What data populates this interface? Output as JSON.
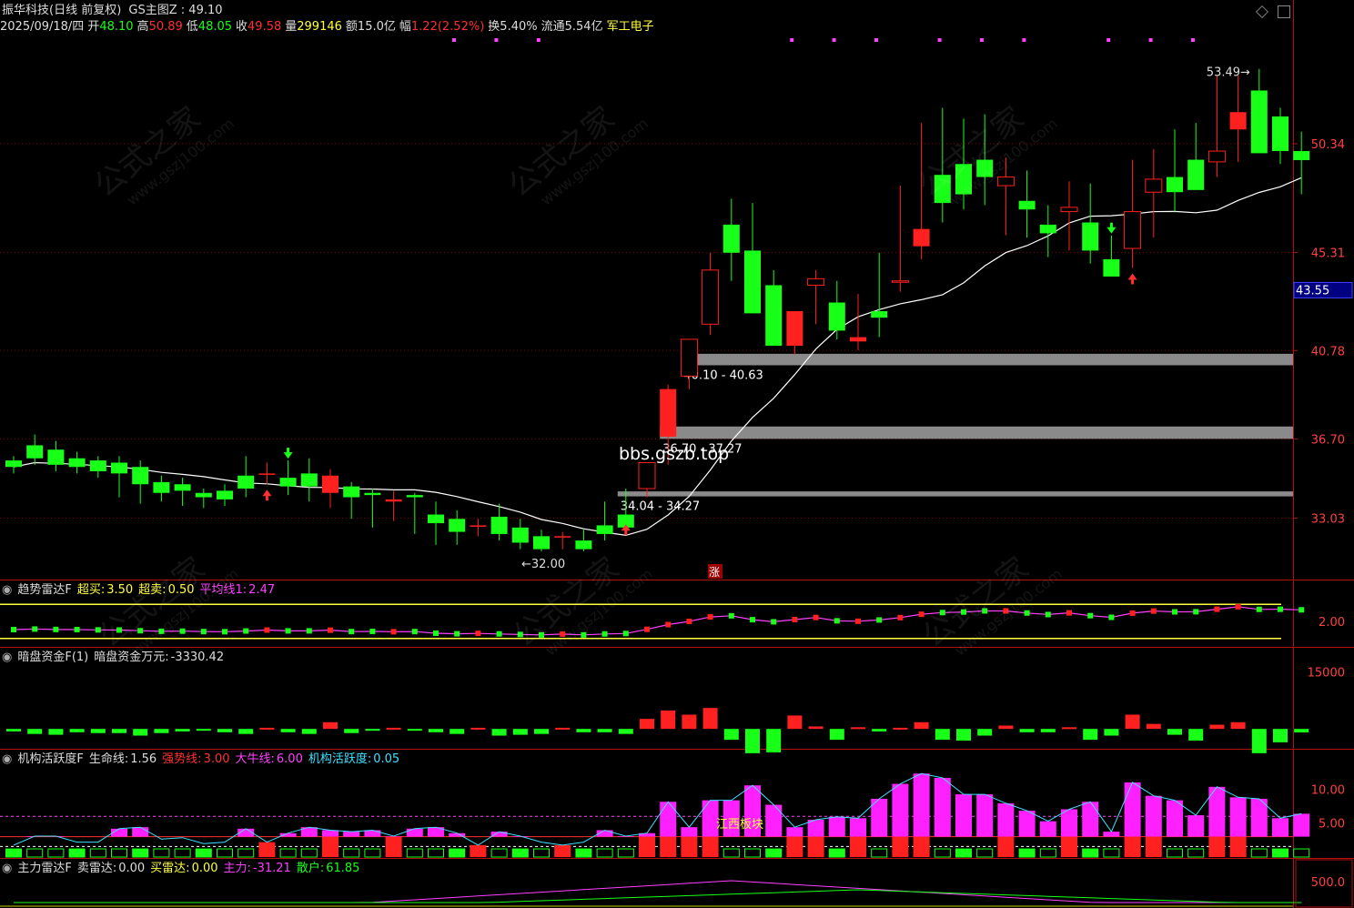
{
  "header": {
    "stock_name": "振华科技(日线 前复权)",
    "main_chart_label": "GS主图Z : 49.10",
    "date": "2025/09/18/四",
    "open_label": "开",
    "open": "48.10",
    "high_label": "高",
    "high": "50.89",
    "low_label": "低",
    "low": "48.05",
    "close_label": "收",
    "close": "49.58",
    "volume_label": "量",
    "volume": "299146",
    "amount_label": "额",
    "amount": "15.0亿",
    "change_label": "幅",
    "change": "1.22(2.52%)",
    "turnover_label": "换",
    "turnover": "5.40%",
    "float_label": "流通",
    "float_cap": "5.54亿",
    "sector": "军工电子"
  },
  "watermarks": {
    "cn": "公式之家",
    "url": "www.gszj100.com"
  },
  "chart_data": [
    {
      "type": "candlestick",
      "ylim": [
        30.7,
        55.3
      ],
      "y_ticks": [
        "50.34",
        "45.31",
        "40.78",
        "36.70",
        "33.03"
      ],
      "current_price_label": "43.55",
      "open": [
        35.7,
        36.4,
        36.2,
        35.8,
        35.7,
        35.6,
        35.4,
        34.7,
        34.6,
        34.2,
        34.3,
        35.0,
        35.1,
        34.9,
        35.1,
        34.2,
        34.5,
        34.2,
        33.8,
        34.1,
        33.2,
        33.0,
        32.7,
        33.1,
        32.6,
        32.2,
        32.2,
        32.0,
        32.7,
        33.2,
        34.4,
        36.8,
        39.6,
        42.0,
        46.6,
        45.4,
        43.8,
        41.0,
        43.8,
        43.0,
        41.2,
        42.6,
        44.0,
        45.6,
        48.9,
        49.4,
        49.6,
        48.4,
        47.7,
        46.6,
        47.2,
        46.7,
        45.0,
        45.5,
        48.1,
        48.8,
        49.6,
        49.5,
        51.0,
        52.8,
        51.6,
        50.0
      ],
      "high": [
        35.9,
        36.9,
        36.6,
        36.1,
        35.9,
        35.9,
        35.7,
        35.0,
        34.9,
        34.4,
        34.6,
        35.9,
        35.6,
        35.7,
        35.8,
        35.3,
        34.7,
        34.4,
        34.3,
        34.2,
        33.8,
        33.4,
        33.0,
        33.7,
        33.0,
        32.5,
        32.4,
        32.5,
        33.8,
        34.4,
        35.6,
        39.2,
        41.0,
        45.3,
        47.8,
        47.6,
        44.5,
        42.6,
        44.5,
        44.0,
        43.4,
        45.3,
        48.4,
        51.3,
        52.0,
        51.5,
        51.7,
        49.7,
        49.1,
        47.5,
        48.6,
        48.5,
        46.1,
        49.6,
        50.1,
        51.0,
        51.3,
        53.5,
        53.5,
        53.8,
        52.0,
        50.9
      ],
      "low": [
        35.1,
        35.5,
        35.2,
        35.1,
        34.9,
        34.0,
        33.7,
        33.8,
        33.6,
        33.5,
        33.6,
        34.0,
        34.6,
        34.1,
        33.8,
        33.5,
        33.0,
        32.6,
        32.9,
        32.3,
        31.8,
        31.8,
        32.2,
        32.0,
        31.6,
        31.5,
        31.6,
        31.5,
        32.0,
        33.0,
        34.0,
        35.5,
        39.0,
        41.5,
        44.0,
        42.8,
        41.0,
        40.6,
        42.0,
        41.3,
        40.8,
        41.4,
        43.5,
        45.0,
        46.7,
        47.3,
        47.5,
        46.1,
        46.0,
        45.1,
        45.4,
        44.8,
        44.4,
        44.6,
        46.0,
        47.2,
        48.5,
        48.8,
        49.5,
        49.9,
        49.4,
        48.0
      ],
      "close": [
        35.4,
        35.8,
        35.5,
        35.4,
        35.2,
        35.1,
        34.6,
        34.2,
        34.3,
        34.0,
        33.9,
        34.4,
        35.1,
        34.5,
        34.5,
        35.0,
        34.0,
        34.1,
        33.9,
        34.0,
        32.8,
        32.4,
        32.7,
        32.3,
        31.9,
        31.6,
        32.2,
        31.6,
        32.3,
        32.6,
        35.6,
        39.0,
        41.3,
        44.5,
        45.3,
        42.5,
        41.0,
        42.6,
        44.1,
        41.7,
        41.4,
        42.3,
        44.0,
        46.4,
        47.6,
        48.0,
        48.8,
        48.8,
        47.3,
        46.2,
        47.4,
        45.4,
        44.2,
        47.2,
        48.7,
        48.1,
        48.2,
        50.0,
        51.8,
        49.9,
        50.0,
        49.58
      ]
    },
    {
      "type": "line",
      "series": [
        {
          "name": "平均线1",
          "values": [
            2.47
          ]
        }
      ]
    }
  ],
  "chart_annotations": {
    "zones": [
      {
        "label": "40.10 - 40.63",
        "low": 40.1,
        "high": 40.63
      },
      {
        "label": "36.70 - 37.27",
        "low": 36.7,
        "high": 37.27
      },
      {
        "label": "34.04 - 34.27",
        "low": 34.04,
        "high": 34.27
      }
    ],
    "low_marker": "←32.00",
    "high_marker": "53.49→",
    "zhang_badge": "涨",
    "site_text": "bbs.gszb.top"
  },
  "panels": {
    "trend": {
      "title": "趋势雷达F",
      "buy_label": "超买:",
      "buy": "3.50",
      "sell_label": "超卖:",
      "sell": "0.50",
      "avg_label": "平均线1:",
      "avg": "2.47",
      "tick": "2.00",
      "ylim": [
        0,
        4
      ]
    },
    "dark_fund": {
      "title": "暗盘资金F(1)",
      "value_label": "暗盘资金万元:",
      "value": "-3330.42",
      "tick": "15000",
      "ylim": [
        -4500,
        17000
      ]
    },
    "inst": {
      "title": "机构活跃度F",
      "life_label": "生命线:",
      "life": "1.56",
      "strong_label": "强势线:",
      "strong": "3.00",
      "bull_label": "大牛线:",
      "bull": "6.00",
      "act_label": "机构活跃度:",
      "act": "0.05",
      "ticks": [
        "10.00",
        "5.00"
      ],
      "annotation": "江西板块",
      "ylim": [
        0,
        13
      ]
    },
    "main_force": {
      "title": "主力雷达F",
      "sell_label": "卖雷达:",
      "sell": "0.00",
      "buy_label": "买雷达:",
      "buy": "0.00",
      "main_label": "主力:",
      "main": "-31.21",
      "retail_label": "散户:",
      "retail": "61.85",
      "tick": "500.0"
    }
  },
  "colors": {
    "up": "#ff2020",
    "down": "#18ff18",
    "ma": "#ffffff",
    "grid": "#8b0000",
    "zone": "#8a8a8a"
  }
}
